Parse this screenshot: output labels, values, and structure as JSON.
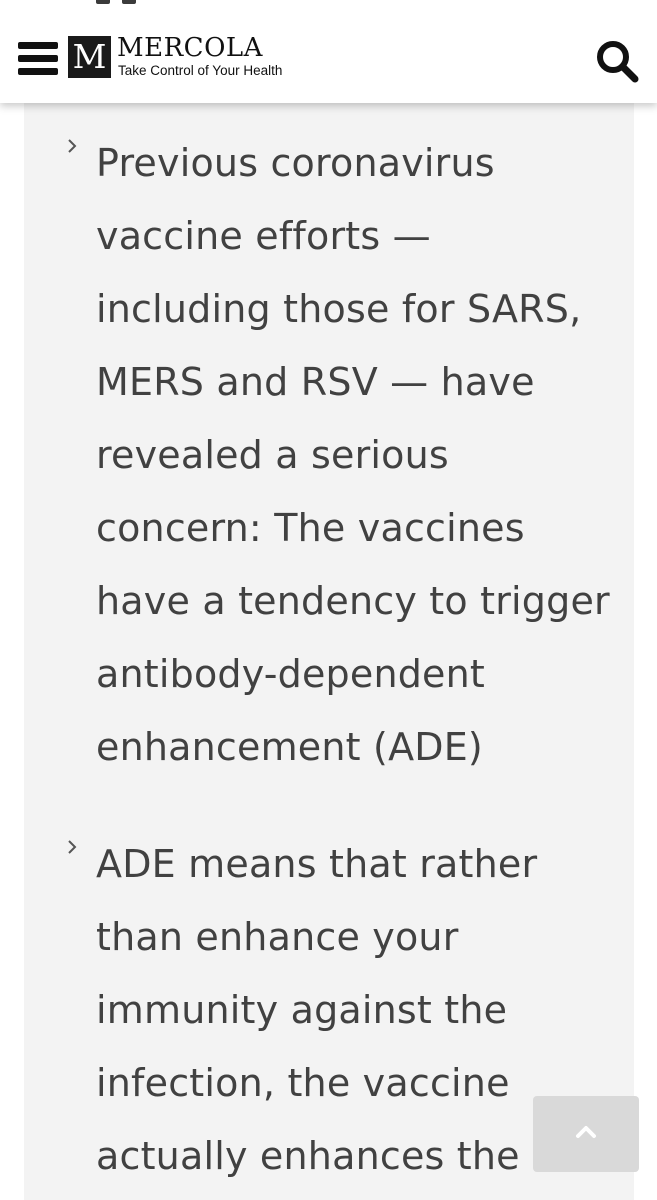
{
  "header": {
    "logo_mark": "M",
    "logo_name": "MERCOLA",
    "logo_tagline": "Take Control of Your Health",
    "menu_icon": "hamburger-menu-icon",
    "search_icon": "search-icon"
  },
  "article": {
    "bullets": [
      {
        "icon": "chevron-right-icon",
        "text": "Previous coronavirus vaccine efforts — including those for SARS, MERS and RSV — have revealed a serious concern: The vaccines have a tendency to trigger antibody-dependent enhancement (ADE)"
      },
      {
        "icon": "chevron-right-icon",
        "text": "ADE means that rather than enhance your immunity against the infection, the vaccine actually enhances the"
      }
    ]
  },
  "scroll_top": {
    "icon": "chevron-up-icon"
  },
  "colors": {
    "panel_background": "#f3f3f3",
    "body_text": "#414141",
    "header_background": "#ffffff",
    "scroll_button": "#d9d9d9"
  }
}
